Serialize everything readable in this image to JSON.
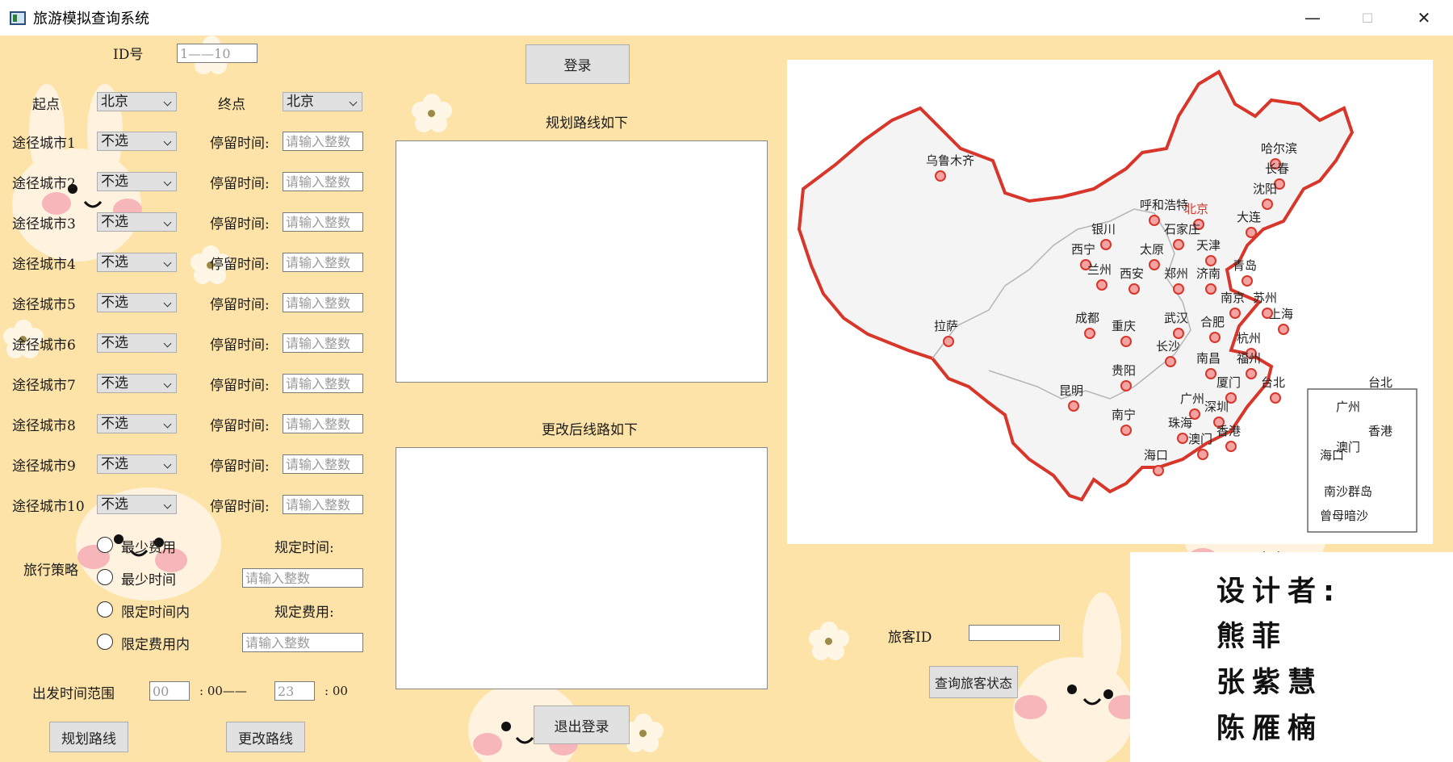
{
  "window": {
    "title": "旅游模拟查询系统",
    "minimize": "—",
    "maximize": "☐",
    "close": "✕"
  },
  "login": {
    "id_label": "ID号",
    "id_placeholder": "1——10",
    "login_button": "登录",
    "logout_button": "退出登录"
  },
  "route": {
    "start_label": "起点",
    "start_value": "北京",
    "end_label": "终点",
    "end_value": "北京",
    "stay_label": "停留时间:",
    "stay_placeholder": "请输入整数",
    "via": [
      {
        "label": "途径城市1",
        "value": "不选"
      },
      {
        "label": "途径城市2",
        "value": "不选"
      },
      {
        "label": "途径城市3",
        "value": "不选"
      },
      {
        "label": "途径城市4",
        "value": "不选"
      },
      {
        "label": "途径城市5",
        "value": "不选"
      },
      {
        "label": "途径城市6",
        "value": "不选"
      },
      {
        "label": "途径城市7",
        "value": "不选"
      },
      {
        "label": "途径城市8",
        "value": "不选"
      },
      {
        "label": "途径城市9",
        "value": "不选"
      },
      {
        "label": "途径城市10",
        "value": "不选"
      }
    ]
  },
  "strategy": {
    "label": "旅行策略",
    "options": [
      "最少费用",
      "最少时间",
      "限定时间内",
      "限定费用内"
    ],
    "time_limit_label": "规定时间:",
    "time_limit_placeholder": "请输入整数",
    "cost_limit_label": "规定费用:",
    "cost_limit_placeholder": "请输入整数"
  },
  "departure": {
    "label": "出发时间范围",
    "from_placeholder": "00",
    "from_suffix": ": 00——",
    "to_placeholder": "23",
    "to_suffix": ": 00"
  },
  "buttons": {
    "plan": "规划路线",
    "change": "更改路线",
    "query_status": "查询旅客状态"
  },
  "results": {
    "planned_title": "规划路线如下",
    "changed_title": "更改后线路如下"
  },
  "passenger": {
    "id_label": "旅客ID",
    "id_value": ""
  },
  "designers": {
    "title": "设计者:",
    "names": [
      "熊菲",
      "张紫慧",
      "陈雁楠"
    ]
  },
  "map": {
    "cities": [
      {
        "name": "哈尔滨"
      },
      {
        "name": "长春"
      },
      {
        "name": "沈阳"
      },
      {
        "name": "乌鲁木齐"
      },
      {
        "name": "呼和浩特"
      },
      {
        "name": "北京"
      },
      {
        "name": "大连"
      },
      {
        "name": "银川"
      },
      {
        "name": "石家庄"
      },
      {
        "name": "天津"
      },
      {
        "name": "西宁"
      },
      {
        "name": "太原"
      },
      {
        "name": "兰州"
      },
      {
        "name": "西安"
      },
      {
        "name": "郑州"
      },
      {
        "name": "济南"
      },
      {
        "name": "青岛"
      },
      {
        "name": "南京"
      },
      {
        "name": "苏州"
      },
      {
        "name": "上海"
      },
      {
        "name": "拉萨"
      },
      {
        "name": "成都"
      },
      {
        "name": "武汉"
      },
      {
        "name": "合肥"
      },
      {
        "name": "重庆"
      },
      {
        "name": "杭州"
      },
      {
        "name": "长沙"
      },
      {
        "name": "南昌"
      },
      {
        "name": "福州"
      },
      {
        "name": "贵阳"
      },
      {
        "name": "昆明"
      },
      {
        "name": "厦门"
      },
      {
        "name": "台北"
      },
      {
        "name": "南宁"
      },
      {
        "name": "广州"
      },
      {
        "name": "深圳"
      },
      {
        "name": "珠海"
      },
      {
        "name": "香港"
      },
      {
        "name": "澳门"
      },
      {
        "name": "海口"
      }
    ],
    "inset": [
      {
        "name": "台北"
      },
      {
        "name": "广州"
      },
      {
        "name": "香港"
      },
      {
        "name": "澳门"
      },
      {
        "name": "海口"
      },
      {
        "name": "南沙群岛"
      },
      {
        "name": "曾母暗沙"
      }
    ]
  }
}
